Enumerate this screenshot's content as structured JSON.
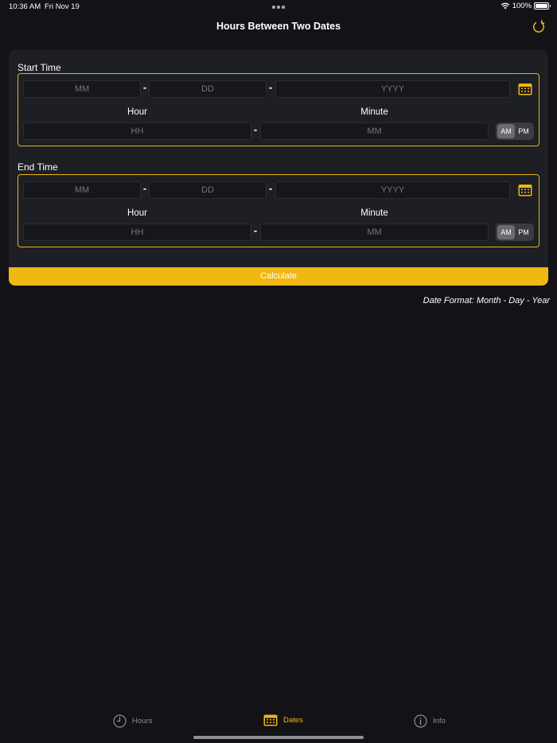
{
  "status": {
    "time": "10:36 AM",
    "date": "Fri Nov 19",
    "battery": "100%"
  },
  "nav": {
    "title": "Hours Between Two Dates"
  },
  "start": {
    "label": "Start Time",
    "month_placeholder": "MM",
    "day_placeholder": "DD",
    "year_placeholder": "YYYY",
    "hour_label": "Hour",
    "minute_label": "Minute",
    "hour_placeholder": "HH",
    "minute_placeholder": "MM",
    "am": "AM",
    "pm": "PM",
    "selected": "AM"
  },
  "end": {
    "label": "End Time",
    "month_placeholder": "MM",
    "day_placeholder": "DD",
    "year_placeholder": "YYYY",
    "hour_label": "Hour",
    "minute_label": "Minute",
    "hour_placeholder": "HH",
    "minute_placeholder": "MM",
    "am": "AM",
    "pm": "PM",
    "selected": "AM"
  },
  "separator": "-",
  "calculate_label": "Calculate",
  "date_format_note": "Date Format: Month - Day - Year",
  "tabs": [
    {
      "label": "Hours",
      "icon": "clock-icon",
      "active": false
    },
    {
      "label": "Dates",
      "icon": "calendar-icon",
      "active": true
    },
    {
      "label": "Info",
      "icon": "info-icon",
      "active": false
    }
  ],
  "colors": {
    "accent": "#f1b713",
    "background": "#131317",
    "card": "#1d1f24",
    "inactive": "#8e8e93"
  }
}
